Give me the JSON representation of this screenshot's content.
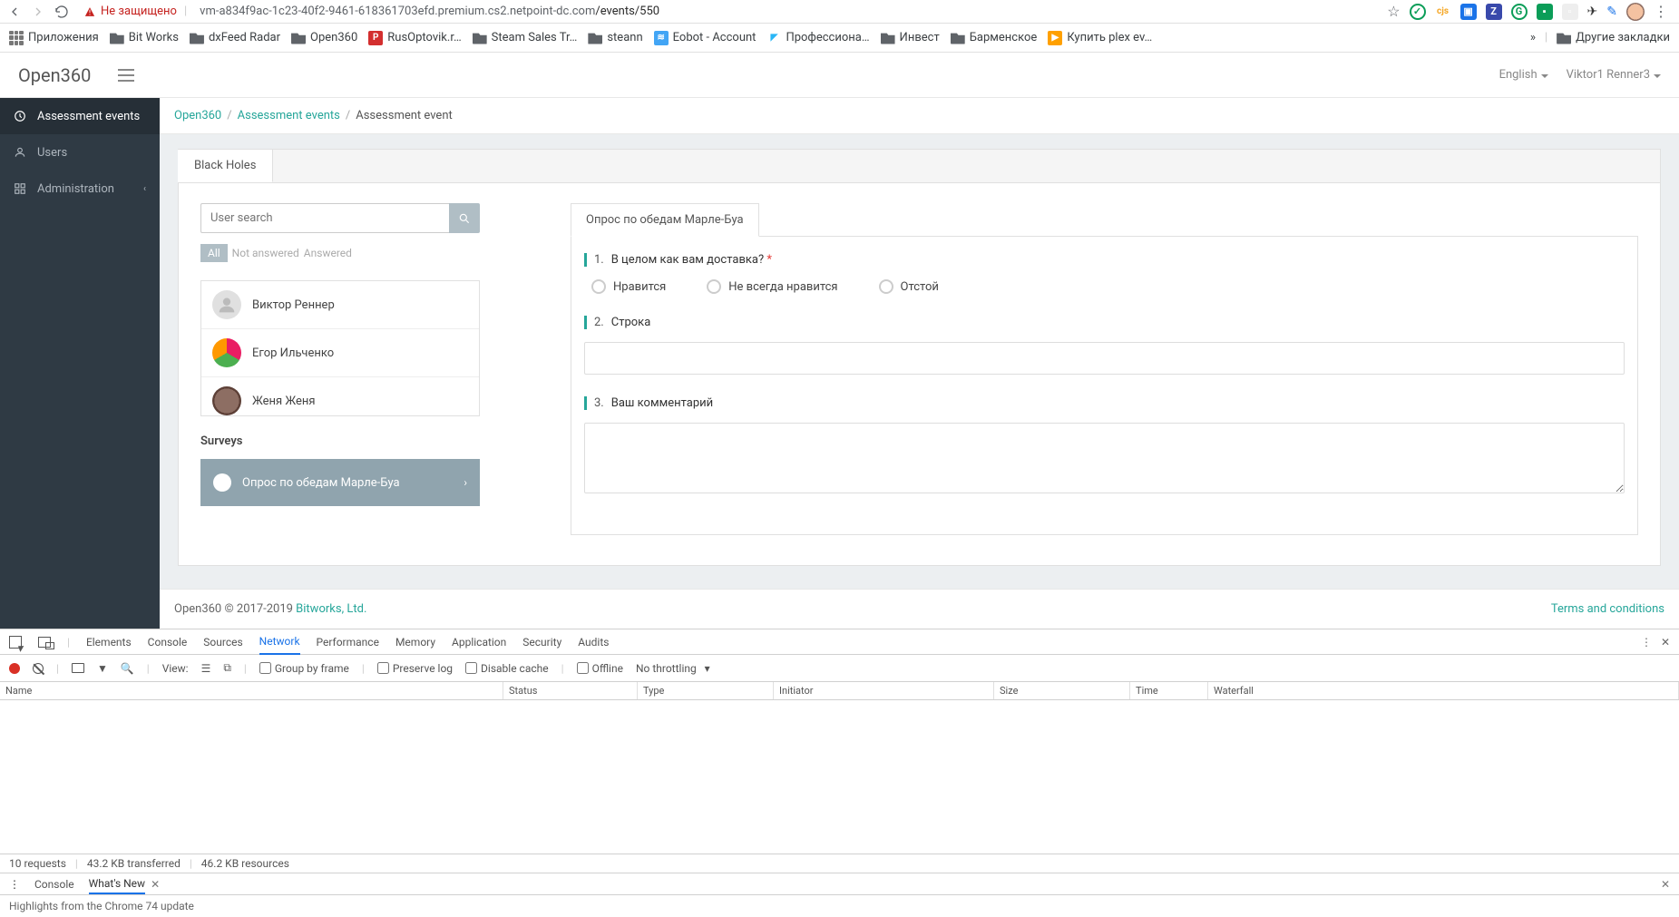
{
  "browser": {
    "security_label": "Не защищено",
    "url_host": "vm-a834f9ac-1c23-40f2-9461-618361703efd.premium.cs2.netpoint-dc.com",
    "url_path": "/events/550"
  },
  "bookmarks": {
    "apps": "Приложения",
    "items": [
      "Bit Works",
      "dxFeed Radar",
      "Open360",
      "RusOptovik.r…",
      "Steam Sales Tr…",
      "steann",
      "Eobot - Account",
      "Профессиона…",
      "Инвест",
      "Барменское",
      "Купить plex ev…"
    ],
    "more": "»",
    "other": "Другие закладки"
  },
  "header": {
    "brand": "Open360",
    "language": "English",
    "user": "Viktor1 Renner3"
  },
  "sidebar": {
    "items": [
      {
        "label": "Assessment events"
      },
      {
        "label": "Users"
      },
      {
        "label": "Administration"
      }
    ]
  },
  "breadcrumb": {
    "root": "Open360",
    "section": "Assessment events",
    "current": "Assessment event"
  },
  "tab": {
    "label": "Black Holes"
  },
  "search": {
    "placeholder": "User search"
  },
  "filters": {
    "all": "All",
    "not": "Not answered",
    "ans": "Answered"
  },
  "users": [
    {
      "name": "Виктор Реннер",
      "avatar": "c1"
    },
    {
      "name": "Егор Ильченко",
      "avatar": "c2"
    },
    {
      "name": "Женя Женя",
      "avatar": "c3"
    }
  ],
  "surveys": {
    "title": "Surveys",
    "items": [
      {
        "label": "Опрос по обедам Марле-Буа"
      }
    ]
  },
  "survey_form": {
    "tab": "Опрос по обедам Марле-Буа",
    "q1": {
      "num": "1.",
      "text": "В целом как вам доставка?",
      "required": "*",
      "opts": [
        "Нравится",
        "Не всегда нравится",
        "Отстой"
      ]
    },
    "q2": {
      "num": "2.",
      "text": "Строка"
    },
    "q3": {
      "num": "3.",
      "text": "Ваш комментарий"
    }
  },
  "footer": {
    "left": "Open360 © 2017-2019 ",
    "company": "Bitworks, Ltd.",
    "right": "Terms and conditions"
  },
  "devtools": {
    "tabs": [
      "Elements",
      "Console",
      "Sources",
      "Network",
      "Performance",
      "Memory",
      "Application",
      "Security",
      "Audits"
    ],
    "toolbar": {
      "view": "View:",
      "group": "Group by frame",
      "preserve": "Preserve log",
      "disable": "Disable cache",
      "offline": "Offline",
      "throttle": "No throttling"
    },
    "columns": [
      "Name",
      "Status",
      "Type",
      "Initiator",
      "Size",
      "Time",
      "Waterfall"
    ],
    "status": {
      "requests": "10 requests",
      "transferred": "43.2 KB transferred",
      "resources": "46.2 KB resources"
    },
    "drawer": {
      "tabs": [
        "Console",
        "What's New"
      ],
      "highlights": "Highlights from the Chrome 74 update"
    }
  }
}
